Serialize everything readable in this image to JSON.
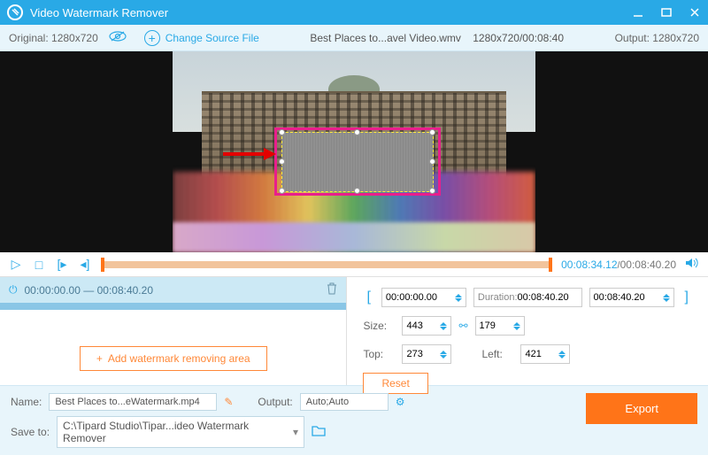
{
  "titlebar": {
    "title": "Video Watermark Remover"
  },
  "infobar": {
    "original_label": "Original:",
    "original_res": "1280x720",
    "change_source": "Change Source File",
    "filename": "Best Places to...avel Video.wmv",
    "fileres": "1280x720",
    "filedur": "00:08:40",
    "output_label": "Output:",
    "output_res": "1280x720"
  },
  "timeline": {
    "current": "00:08:34.12",
    "total": "00:08:40.20"
  },
  "segment": {
    "start": "00:00:00.00",
    "end": "00:08:40.20",
    "sep": "—"
  },
  "addarea_label": "Add watermark removing area",
  "range": {
    "start": "00:00:00.00",
    "duration_label": "Duration:",
    "duration": "00:08:40.20",
    "end": "00:08:40.20"
  },
  "size": {
    "label": "Size:",
    "w": "443",
    "h": "179"
  },
  "pos": {
    "top_label": "Top:",
    "top": "273",
    "left_label": "Left:",
    "left": "421"
  },
  "reset_label": "Reset",
  "bottom": {
    "name_label": "Name:",
    "name_value": "Best Places to...eWatermark.mp4",
    "output_label": "Output:",
    "output_value": "Auto;Auto",
    "saveto_label": "Save to:",
    "saveto_value": "C:\\Tipard Studio\\Tipar...ideo Watermark Remover",
    "export": "Export"
  }
}
